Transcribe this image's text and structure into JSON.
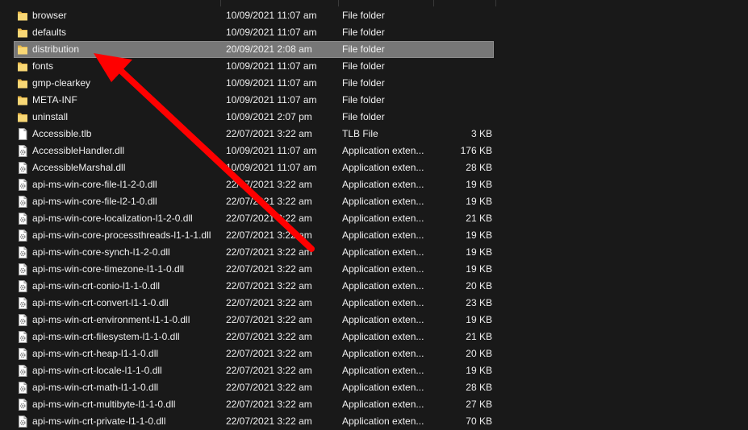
{
  "files": [
    {
      "name": "browser",
      "date": "10/09/2021 11:07 am",
      "type": "File folder",
      "size": "",
      "icon": "folder-icon",
      "selected": false
    },
    {
      "name": "defaults",
      "date": "10/09/2021 11:07 am",
      "type": "File folder",
      "size": "",
      "icon": "folder-icon",
      "selected": false
    },
    {
      "name": "distribution",
      "date": "20/09/2021 2:08 am",
      "type": "File folder",
      "size": "",
      "icon": "folder-icon",
      "selected": true
    },
    {
      "name": "fonts",
      "date": "10/09/2021 11:07 am",
      "type": "File folder",
      "size": "",
      "icon": "folder-icon",
      "selected": false
    },
    {
      "name": "gmp-clearkey",
      "date": "10/09/2021 11:07 am",
      "type": "File folder",
      "size": "",
      "icon": "folder-icon",
      "selected": false
    },
    {
      "name": "META-INF",
      "date": "10/09/2021 11:07 am",
      "type": "File folder",
      "size": "",
      "icon": "folder-icon",
      "selected": false
    },
    {
      "name": "uninstall",
      "date": "10/09/2021 2:07 pm",
      "type": "File folder",
      "size": "",
      "icon": "folder-icon",
      "selected": false
    },
    {
      "name": "Accessible.tlb",
      "date": "22/07/2021 3:22 am",
      "type": "TLB File",
      "size": "3 KB",
      "icon": "document-file-icon",
      "selected": false
    },
    {
      "name": "AccessibleHandler.dll",
      "date": "10/09/2021 11:07 am",
      "type": "Application exten...",
      "size": "176 KB",
      "icon": "dll-file-icon",
      "selected": false
    },
    {
      "name": "AccessibleMarshal.dll",
      "date": "10/09/2021 11:07 am",
      "type": "Application exten...",
      "size": "28 KB",
      "icon": "dll-file-icon",
      "selected": false
    },
    {
      "name": "api-ms-win-core-file-l1-2-0.dll",
      "date": "22/07/2021 3:22 am",
      "type": "Application exten...",
      "size": "19 KB",
      "icon": "dll-file-icon",
      "selected": false
    },
    {
      "name": "api-ms-win-core-file-l2-1-0.dll",
      "date": "22/07/2021 3:22 am",
      "type": "Application exten...",
      "size": "19 KB",
      "icon": "dll-file-icon",
      "selected": false
    },
    {
      "name": "api-ms-win-core-localization-l1-2-0.dll",
      "date": "22/07/2021 3:22 am",
      "type": "Application exten...",
      "size": "21 KB",
      "icon": "dll-file-icon",
      "selected": false
    },
    {
      "name": "api-ms-win-core-processthreads-l1-1-1.dll",
      "date": "22/07/2021 3:22 am",
      "type": "Application exten...",
      "size": "19 KB",
      "icon": "dll-file-icon",
      "selected": false
    },
    {
      "name": "api-ms-win-core-synch-l1-2-0.dll",
      "date": "22/07/2021 3:22 am",
      "type": "Application exten...",
      "size": "19 KB",
      "icon": "dll-file-icon",
      "selected": false
    },
    {
      "name": "api-ms-win-core-timezone-l1-1-0.dll",
      "date": "22/07/2021 3:22 am",
      "type": "Application exten...",
      "size": "19 KB",
      "icon": "dll-file-icon",
      "selected": false
    },
    {
      "name": "api-ms-win-crt-conio-l1-1-0.dll",
      "date": "22/07/2021 3:22 am",
      "type": "Application exten...",
      "size": "20 KB",
      "icon": "dll-file-icon",
      "selected": false
    },
    {
      "name": "api-ms-win-crt-convert-l1-1-0.dll",
      "date": "22/07/2021 3:22 am",
      "type": "Application exten...",
      "size": "23 KB",
      "icon": "dll-file-icon",
      "selected": false
    },
    {
      "name": "api-ms-win-crt-environment-l1-1-0.dll",
      "date": "22/07/2021 3:22 am",
      "type": "Application exten...",
      "size": "19 KB",
      "icon": "dll-file-icon",
      "selected": false
    },
    {
      "name": "api-ms-win-crt-filesystem-l1-1-0.dll",
      "date": "22/07/2021 3:22 am",
      "type": "Application exten...",
      "size": "21 KB",
      "icon": "dll-file-icon",
      "selected": false
    },
    {
      "name": "api-ms-win-crt-heap-l1-1-0.dll",
      "date": "22/07/2021 3:22 am",
      "type": "Application exten...",
      "size": "20 KB",
      "icon": "dll-file-icon",
      "selected": false
    },
    {
      "name": "api-ms-win-crt-locale-l1-1-0.dll",
      "date": "22/07/2021 3:22 am",
      "type": "Application exten...",
      "size": "19 KB",
      "icon": "dll-file-icon",
      "selected": false
    },
    {
      "name": "api-ms-win-crt-math-l1-1-0.dll",
      "date": "22/07/2021 3:22 am",
      "type": "Application exten...",
      "size": "28 KB",
      "icon": "dll-file-icon",
      "selected": false
    },
    {
      "name": "api-ms-win-crt-multibyte-l1-1-0.dll",
      "date": "22/07/2021 3:22 am",
      "type": "Application exten...",
      "size": "27 KB",
      "icon": "dll-file-icon",
      "selected": false
    },
    {
      "name": "api-ms-win-crt-private-l1-1-0.dll",
      "date": "22/07/2021 3:22 am",
      "type": "Application exten...",
      "size": "70 KB",
      "icon": "dll-file-icon",
      "selected": false
    }
  ],
  "annotation": {
    "icon": "red-arrow-icon",
    "color": "#ff0000",
    "points_to": "distribution"
  },
  "colors": {
    "background": "#191919",
    "text": "#f0f0f0",
    "selection": "#777777",
    "folder": "#f8d775"
  }
}
